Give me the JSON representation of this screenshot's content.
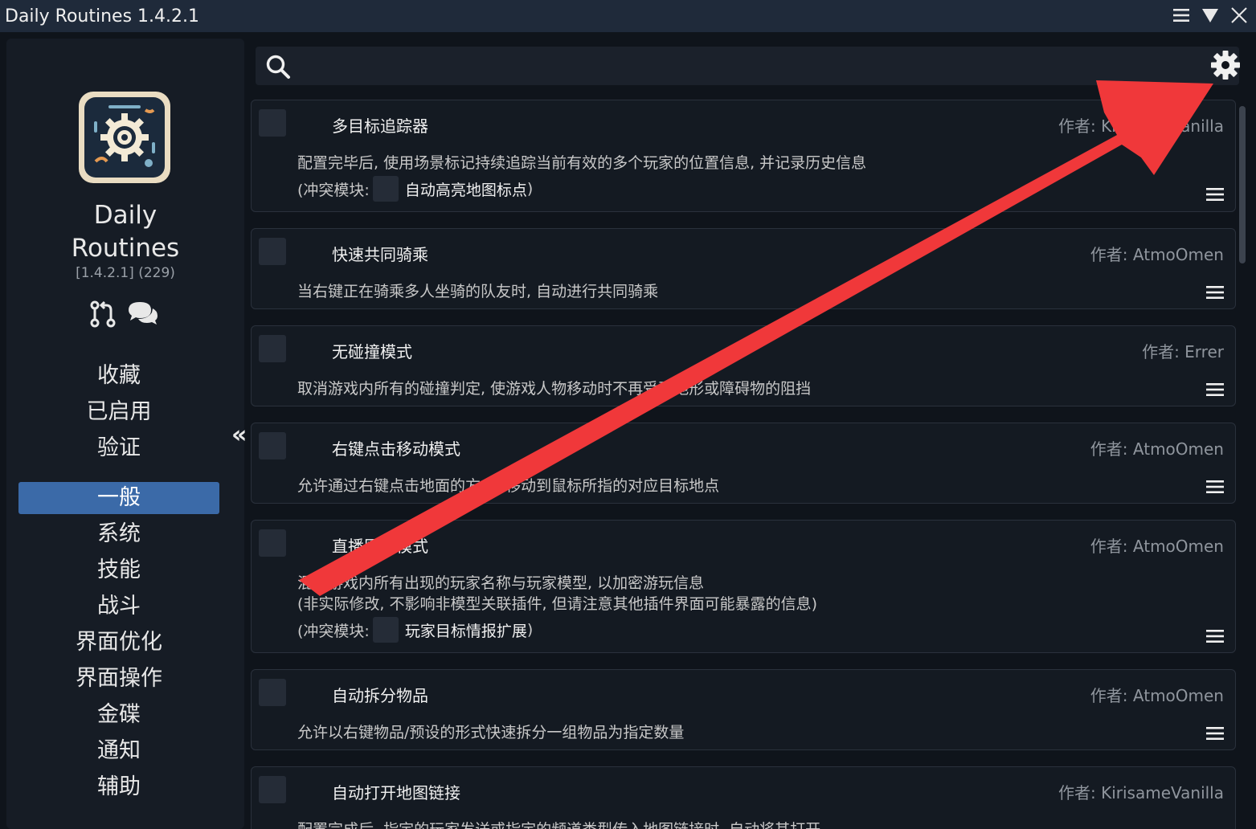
{
  "window": {
    "title": "Daily Routines 1.4.2.1"
  },
  "sidebar": {
    "app_name": "Daily Routines",
    "version": "[1.4.2.1] (229)",
    "top_nav": [
      "收藏",
      "已启用",
      "验证"
    ],
    "categories": [
      "一般",
      "系统",
      "技能",
      "战斗",
      "界面优化",
      "界面操作",
      "金碟",
      "通知",
      "辅助"
    ],
    "active_category": "一般",
    "collapse_glyph": "«"
  },
  "search": {
    "value": "",
    "placeholder": ""
  },
  "modules": [
    {
      "title": "多目标追踪器",
      "author": "作者: KirisameVanilla",
      "desc": [
        "配置完毕后, 使用场景标记持续追踪当前有效的多个玩家的位置信息, 并记录历史信息"
      ],
      "conflict_prefix": "(冲突模块:",
      "conflict_module": "自动高亮地图标点",
      "conflict_suffix": ")"
    },
    {
      "title": "快速共同骑乘",
      "author": "作者: AtmoOmen",
      "desc": [
        "当右键正在骑乘多人坐骑的队友时, 自动进行共同骑乘"
      ]
    },
    {
      "title": "无碰撞模式",
      "author": "作者: Errer",
      "desc": [
        "取消游戏内所有的碰撞判定, 使游戏人物移动时不再受到地形或障碍物的阻挡"
      ]
    },
    {
      "title": "右键点击移动模式",
      "author": "作者: AtmoOmen",
      "desc": [
        "允许通过右键点击地面的方式, 移动到鼠标所指的对应目标地点"
      ]
    },
    {
      "title": "直播匿名模式",
      "author": "作者: AtmoOmen",
      "desc": [
        "混淆游戏内所有出现的玩家名称与玩家模型, 以加密游玩信息",
        "(非实际修改, 不影响非模型关联插件, 但请注意其他插件界面可能暴露的信息)"
      ],
      "conflict_prefix": "(冲突模块:",
      "conflict_module": "玩家目标情报扩展",
      "conflict_suffix": ")"
    },
    {
      "title": "自动拆分物品",
      "author": "作者: AtmoOmen",
      "desc": [
        "允许以右键物品/预设的形式快速拆分一组物品为指定数量"
      ]
    },
    {
      "title": "自动打开地图链接",
      "author": "作者: KirisameVanilla",
      "desc": [
        "配置完成后, 指定的玩家发送或指定的频道类型传入地图链接时, 自动将其打开"
      ]
    }
  ],
  "colors": {
    "accent": "#3b6aa8",
    "annotation_arrow": "#f0383a"
  },
  "icons": {
    "titlebar": [
      "hamburger-icon",
      "triangle-down-icon",
      "close-icon"
    ],
    "toolbar": [
      "search-icon",
      "gear-icon"
    ],
    "sidebar": [
      "git-pull-request-icon",
      "chat-bubbles-icon"
    ],
    "card": [
      "hamburger-menu-icon"
    ]
  }
}
